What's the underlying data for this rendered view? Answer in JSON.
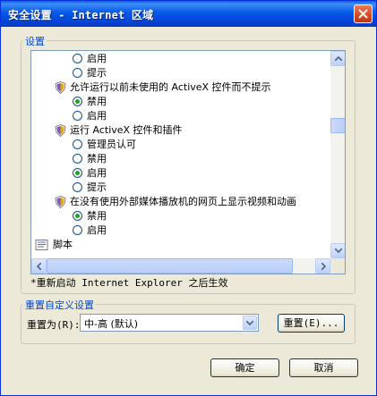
{
  "window": {
    "title": "安全设置 - Internet 区域"
  },
  "settings_group": {
    "legend": "设置",
    "rows": [
      {
        "type": "option",
        "label": "启用",
        "checked": false
      },
      {
        "type": "option",
        "label": "提示",
        "checked": false
      },
      {
        "type": "category",
        "label": "允许运行以前未使用的 ActiveX 控件而不提示",
        "icon": "activex-shield-icon"
      },
      {
        "type": "option",
        "label": "禁用",
        "checked": true
      },
      {
        "type": "option",
        "label": "启用",
        "checked": false
      },
      {
        "type": "category",
        "label": "运行 ActiveX 控件和插件",
        "icon": "activex-shield-icon"
      },
      {
        "type": "option",
        "label": "管理员认可",
        "checked": false
      },
      {
        "type": "option",
        "label": "禁用",
        "checked": false
      },
      {
        "type": "option",
        "label": "启用",
        "checked": true
      },
      {
        "type": "option",
        "label": "提示",
        "checked": false
      },
      {
        "type": "category",
        "label": "在没有使用外部媒体播放机的网页上显示视频和动画",
        "icon": "activex-shield-icon"
      },
      {
        "type": "option",
        "label": "禁用",
        "checked": true
      },
      {
        "type": "option",
        "label": "启用",
        "checked": false
      },
      {
        "type": "section",
        "label": "脚本",
        "icon": "script-icon"
      }
    ],
    "restart_note": "*重新启动 Internet Explorer 之后生效"
  },
  "reset_group": {
    "legend": "重置自定义设置",
    "reset_to_label": "重置为(R):",
    "reset_level": "中-高 (默认)",
    "reset_button": "重置(E)..."
  },
  "footer": {
    "ok_button": "确定",
    "cancel_button": "取消"
  }
}
